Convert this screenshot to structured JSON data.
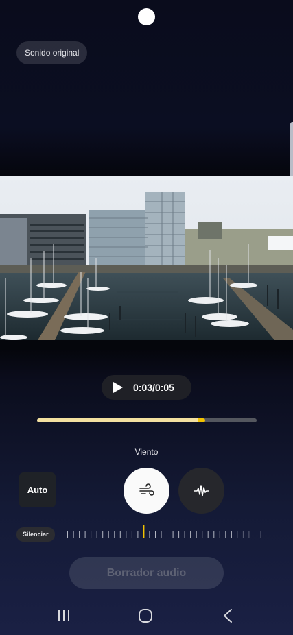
{
  "header": {
    "sound_mode_label": "Sonido original"
  },
  "player": {
    "timecode": "0:03/0:05",
    "progress_fraction": 0.74
  },
  "effects": {
    "section_label": "Viento",
    "auto_label": "Auto",
    "options": [
      {
        "name": "wind",
        "icon": "wind-icon",
        "selected": true
      },
      {
        "name": "voice",
        "icon": "waveform-icon",
        "selected": false
      }
    ]
  },
  "slider": {
    "min_label": "Silenciar",
    "level_fraction": 0.42
  },
  "actions": {
    "eraser_label": "Borrador audio"
  },
  "navbar": {
    "items": [
      "recent-apps-icon",
      "home-icon",
      "back-icon"
    ]
  },
  "colors": {
    "accent": "#f2c200",
    "progress": "#f3e0a0"
  }
}
